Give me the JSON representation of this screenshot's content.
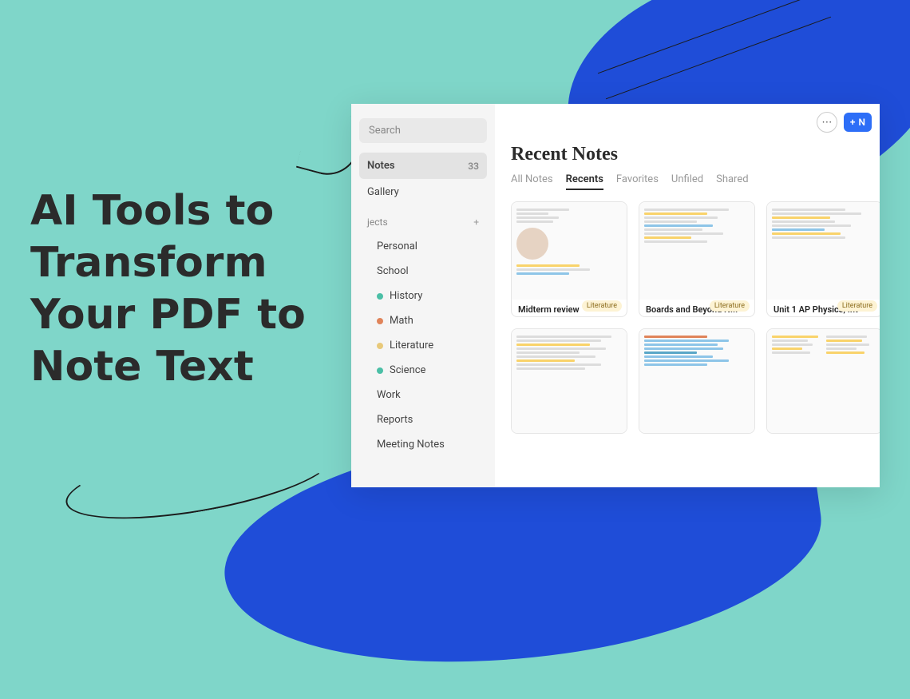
{
  "hero": {
    "title": "AI Tools to Transform Your PDF to Note Text"
  },
  "sidebar": {
    "search_placeholder": "Search",
    "items": [
      {
        "label": "Notes",
        "count": "33",
        "active": true
      },
      {
        "label": "Gallery"
      }
    ],
    "subjects_label": "jects",
    "add_label": "+",
    "subjects": [
      {
        "label": "Personal"
      },
      {
        "label": "School"
      },
      {
        "label": "History",
        "color": "#4bbfa6"
      },
      {
        "label": "Math",
        "color": "#e0845a"
      },
      {
        "label": "Literature",
        "color": "#e8c97a"
      },
      {
        "label": "Science",
        "color": "#4bbfa6"
      },
      {
        "label": "Work"
      },
      {
        "label": "Reports"
      },
      {
        "label": "Meeting Notes"
      }
    ]
  },
  "toolbar": {
    "more_icon": "⋯",
    "new_icon": "+",
    "new_label": "N"
  },
  "main": {
    "title": "Recent Notes",
    "tabs": [
      {
        "label": "All Notes"
      },
      {
        "label": "Recents",
        "active": true
      },
      {
        "label": "Favorites"
      },
      {
        "label": "Unfiled"
      },
      {
        "label": "Shared"
      }
    ],
    "cards": [
      {
        "title": "Midterm review",
        "tag": "Literature"
      },
      {
        "title": "Boards and Beyond N...",
        "tag": "Literature"
      },
      {
        "title": "Unit 1 AP Physics, Int",
        "tag": "Literature"
      },
      {
        "title": "",
        "tag": ""
      },
      {
        "title": "",
        "tag": ""
      },
      {
        "title": "",
        "tag": ""
      }
    ]
  }
}
